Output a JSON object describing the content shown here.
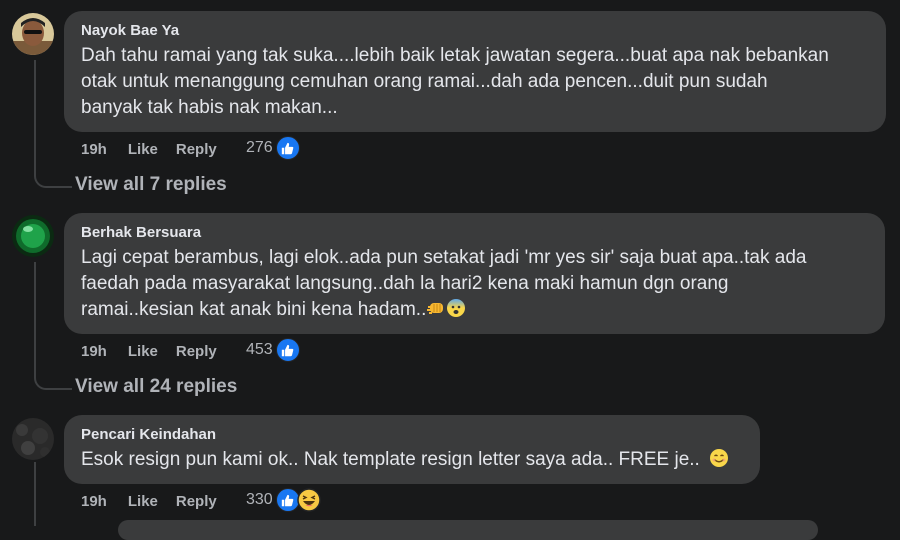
{
  "comments": [
    {
      "author": "Nayok Bae Ya",
      "lines": [
        "Dah tahu ramai yang tak suka....lebih baik letak jawatan segera...buat apa nak bebankan",
        "otak untuk menanggung cemuhan orang ramai...dah ada pencen...duit pun sudah",
        "banyak tak habis nak makan..."
      ],
      "time": "19h",
      "like_label": "Like",
      "reply_label": "Reply",
      "reaction_count": "276",
      "view_replies": "View all 7 replies"
    },
    {
      "author": "Berhak Bersuara",
      "lines": [
        "Lagi cepat berambus, lagi elok..ada pun setakat jadi 'mr yes sir' saja buat apa..tak ada",
        "faedah pada masyarakat langsung..dah la hari2 kena maki hamun dgn orang",
        "ramai..kesian kat anak bini kena hadam.."
      ],
      "time": "19h",
      "like_label": "Like",
      "reply_label": "Reply",
      "reaction_count": "453",
      "view_replies": "View all 24 replies"
    },
    {
      "author": "Pencari Keindahan",
      "lines": [
        "Esok resign pun kami ok.. Nak template resign letter saya ada.. FREE je.."
      ],
      "time": "19h",
      "like_label": "Like",
      "reply_label": "Reply",
      "reaction_count": "330"
    }
  ],
  "colors": {
    "background": "#18191a",
    "bubble": "#3a3b3c",
    "text": "#e4e6eb",
    "secondary": "#b0b3b8",
    "like_blue": "#1877f2"
  },
  "icons": {
    "like": "like-reaction-icon",
    "haha": "haha-reaction-icon",
    "fist": "oncoming-fist-emoji",
    "fearful": "anxious-face-emoji",
    "smile": "smiling-face-emoji"
  }
}
